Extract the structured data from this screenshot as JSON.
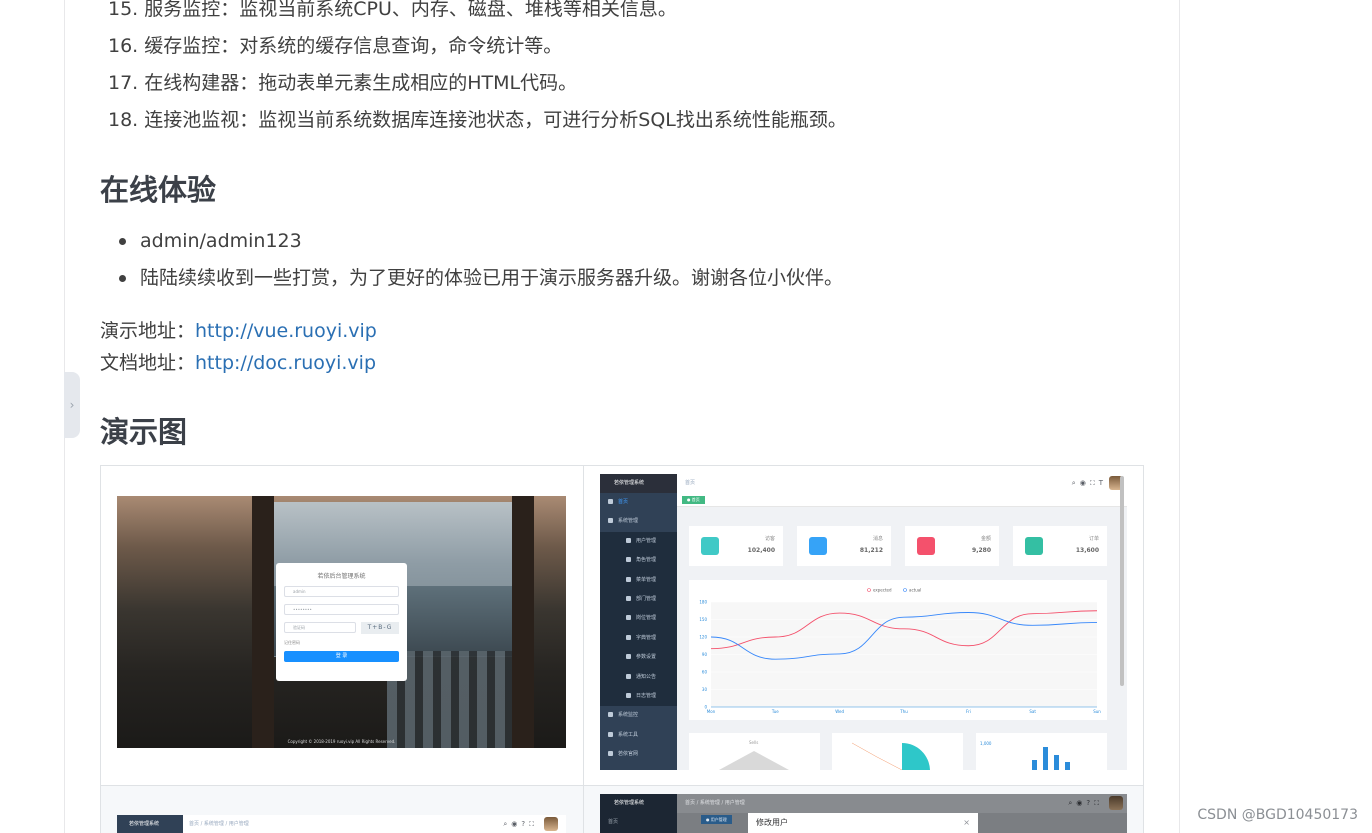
{
  "features": [
    "15. 服务监控：监视当前系统CPU、内存、磁盘、堆栈等相关信息。",
    "16. 缓存监控：对系统的缓存信息查询，命令统计等。",
    "17. 在线构建器：拖动表单元素生成相应的HTML代码。",
    "18. 连接池监视：监视当前系统数据库连接池状态，可进行分析SQL找出系统性能瓶颈。"
  ],
  "online": {
    "heading": "在线体验",
    "bullets": [
      "admin/admin123",
      "陆陆续续收到一些打赏，为了更好的体验已用于演示服务器升级。谢谢各位小伙伴。"
    ],
    "demo_label": "演示地址：",
    "demo_url": "http://vue.ruoyi.vip",
    "docs_label": "文档地址：",
    "docs_url": "http://doc.ruoyi.vip"
  },
  "demo": {
    "heading": "演示图",
    "login": {
      "title": "若依后台管理系统",
      "username": "admin",
      "password": "••••••••",
      "code_placeholder": "验证码",
      "captcha": "T+B-G",
      "remember": "记住密码",
      "button": "登 录",
      "footer": "Copyright © 2018-2019 ruoyi.vip All Rights Reserved."
    },
    "dashboard": {
      "logo": "若依管理系统",
      "breadcrumb": "首页",
      "tag": "● 首页",
      "menu": [
        {
          "label": "首页",
          "sub": false,
          "active": true
        },
        {
          "label": "系统管理",
          "sub": false,
          "active": false
        },
        {
          "label": "用户管理",
          "sub": true,
          "active": false
        },
        {
          "label": "角色管理",
          "sub": true,
          "active": false
        },
        {
          "label": "菜单管理",
          "sub": true,
          "active": false
        },
        {
          "label": "部门管理",
          "sub": true,
          "active": false
        },
        {
          "label": "岗位管理",
          "sub": true,
          "active": false
        },
        {
          "label": "字典管理",
          "sub": true,
          "active": false
        },
        {
          "label": "参数设置",
          "sub": true,
          "active": false
        },
        {
          "label": "通知公告",
          "sub": true,
          "active": false
        },
        {
          "label": "日志管理",
          "sub": true,
          "active": false
        },
        {
          "label": "系统监控",
          "sub": false,
          "active": false
        },
        {
          "label": "系统工具",
          "sub": false,
          "active": false
        },
        {
          "label": "若依官网",
          "sub": false,
          "active": false
        }
      ],
      "panels": [
        {
          "label": "访客",
          "value": "102,400",
          "icon": "peoples-icon",
          "color": "#40c9c6"
        },
        {
          "label": "消息",
          "value": "81,212",
          "icon": "message-icon",
          "color": "#36a3f7"
        },
        {
          "label": "金额",
          "value": "9,280",
          "icon": "money-icon",
          "color": "#f4516c"
        },
        {
          "label": "订单",
          "value": "13,600",
          "icon": "shopping-icon",
          "color": "#34bfa3"
        }
      ],
      "bottom_cards": [
        "Sells",
        "",
        "1,000"
      ]
    },
    "row2": {
      "thumb3_logo": "若依管理系统",
      "thumb3_breadcrumb": "首页 / 系统管理 / 用户管理",
      "thumb4_logo": "若依管理系统",
      "thumb4_menu": "首页",
      "thumb4_breadcrumb": "首页 / 系统管理 / 用户管理",
      "thumb4_tag": "● 用户管理",
      "thumb4_dialog": "修改用户"
    }
  },
  "chart_data": {
    "type": "line",
    "categories": [
      "Mon",
      "Tue",
      "Wed",
      "Thu",
      "Fri",
      "Sat",
      "Sun"
    ],
    "series": [
      {
        "name": "expected",
        "values": [
          100,
          120,
          161,
          134,
          105,
          160,
          165
        ],
        "color": "#f4516c"
      },
      {
        "name": "actual",
        "values": [
          120,
          82,
          91,
          154,
          162,
          140,
          145
        ],
        "color": "#3888fa"
      }
    ],
    "yticks": [
      0,
      30,
      60,
      90,
      120,
      150,
      180
    ],
    "ylim": [
      0,
      180
    ],
    "legend": "top-center",
    "grid": true
  },
  "watermark": "CSDN @BGD10450173"
}
